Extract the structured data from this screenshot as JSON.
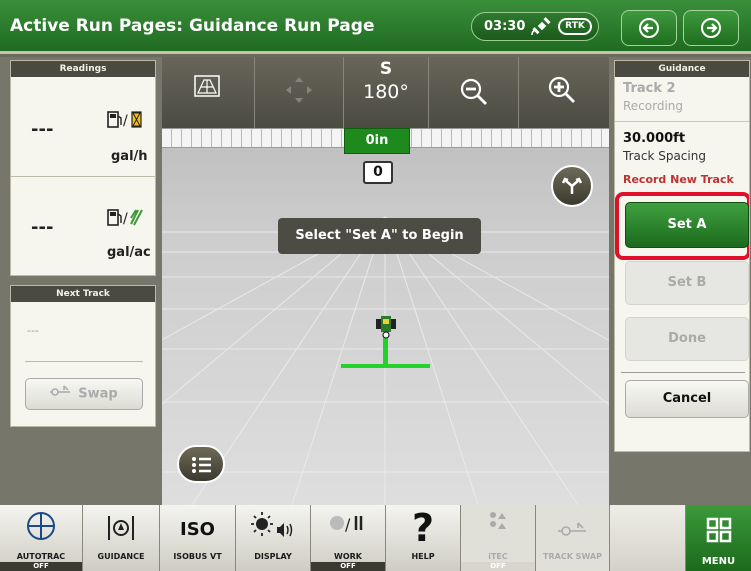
{
  "header": {
    "title": "Active Run Pages: Guidance Run Page",
    "time": "03:30",
    "rtk": "RTK",
    "back_icon": "back-arrow-icon",
    "forward_icon": "forward-arrow-icon"
  },
  "readings": {
    "title": "Readings",
    "items": [
      {
        "value": "---",
        "unit": "gal/h",
        "icon": "fuel-rate-icon"
      },
      {
        "value": "---",
        "unit": "gal/ac",
        "icon": "fuel-per-area-icon"
      }
    ]
  },
  "next_track": {
    "title": "Next Track",
    "value": "---",
    "swap_label": "Swap"
  },
  "map": {
    "heading_dir": "S",
    "heading_deg": "180°",
    "offset": "0in",
    "track_number": "0",
    "message": "Select \"Set A\" to Begin"
  },
  "guidance": {
    "title": "Guidance",
    "track_name": "Track 2",
    "track_status": "Recording",
    "spacing_value": "30.000ft",
    "spacing_label": "Track Spacing",
    "record_label": "Record New Track",
    "set_a": "Set A",
    "set_b": "Set B",
    "done": "Done",
    "cancel": "Cancel"
  },
  "bottom_bar": [
    {
      "label": "AUTOTRAC",
      "state": "OFF",
      "icon": "autotrac-icon"
    },
    {
      "label": "GUIDANCE",
      "state": "",
      "icon": "guidance-icon"
    },
    {
      "label": "ISOBUS VT",
      "state": "",
      "icon": "iso-icon"
    },
    {
      "label": "DISPLAY",
      "state": "",
      "icon": "display-brightness-icon"
    },
    {
      "label": "WORK",
      "state": "OFF",
      "icon": "work-icon"
    },
    {
      "label": "HELP",
      "state": "",
      "icon": "help-icon"
    },
    {
      "label": "iTEC",
      "state": "OFF",
      "icon": "itec-icon"
    },
    {
      "label": "TRACK SWAP",
      "state": "",
      "icon": "track-swap-icon"
    },
    {
      "label": "",
      "state": "",
      "icon": ""
    },
    {
      "label": "MENU",
      "state": "",
      "icon": "menu-grid-icon"
    }
  ],
  "colors": {
    "header_green": "#1f6b22",
    "accent_green": "#2f8a2f",
    "highlight_red": "#e0102a",
    "guidance_line": "#22d22a"
  }
}
